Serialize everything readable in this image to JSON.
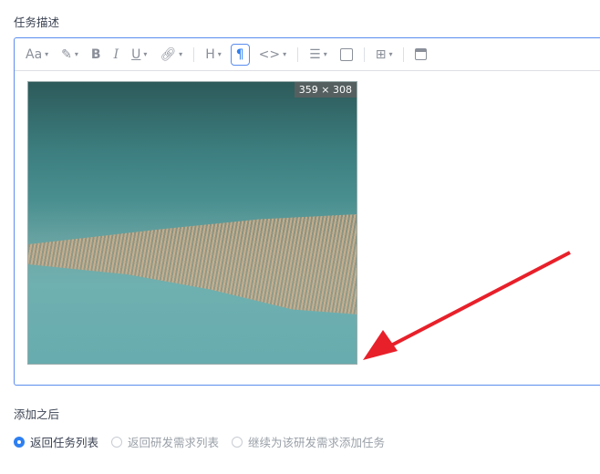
{
  "form": {
    "description_label": "任务描述",
    "after_add_label": "添加之后"
  },
  "toolbar": {
    "font_size": "Aa",
    "bold": "B",
    "italic": "I",
    "underline": "U",
    "heading": "H",
    "paragraph": "¶",
    "code": "<>"
  },
  "image": {
    "size_badge": "359 × 308"
  },
  "after_add_options": [
    {
      "label": "返回任务列表",
      "selected": true
    },
    {
      "label": "返回研发需求列表",
      "selected": false
    },
    {
      "label": "继续为该研发需求添加任务",
      "selected": false
    }
  ],
  "colors": {
    "accent": "#2e7ff1",
    "arrow": "#e8202a"
  }
}
